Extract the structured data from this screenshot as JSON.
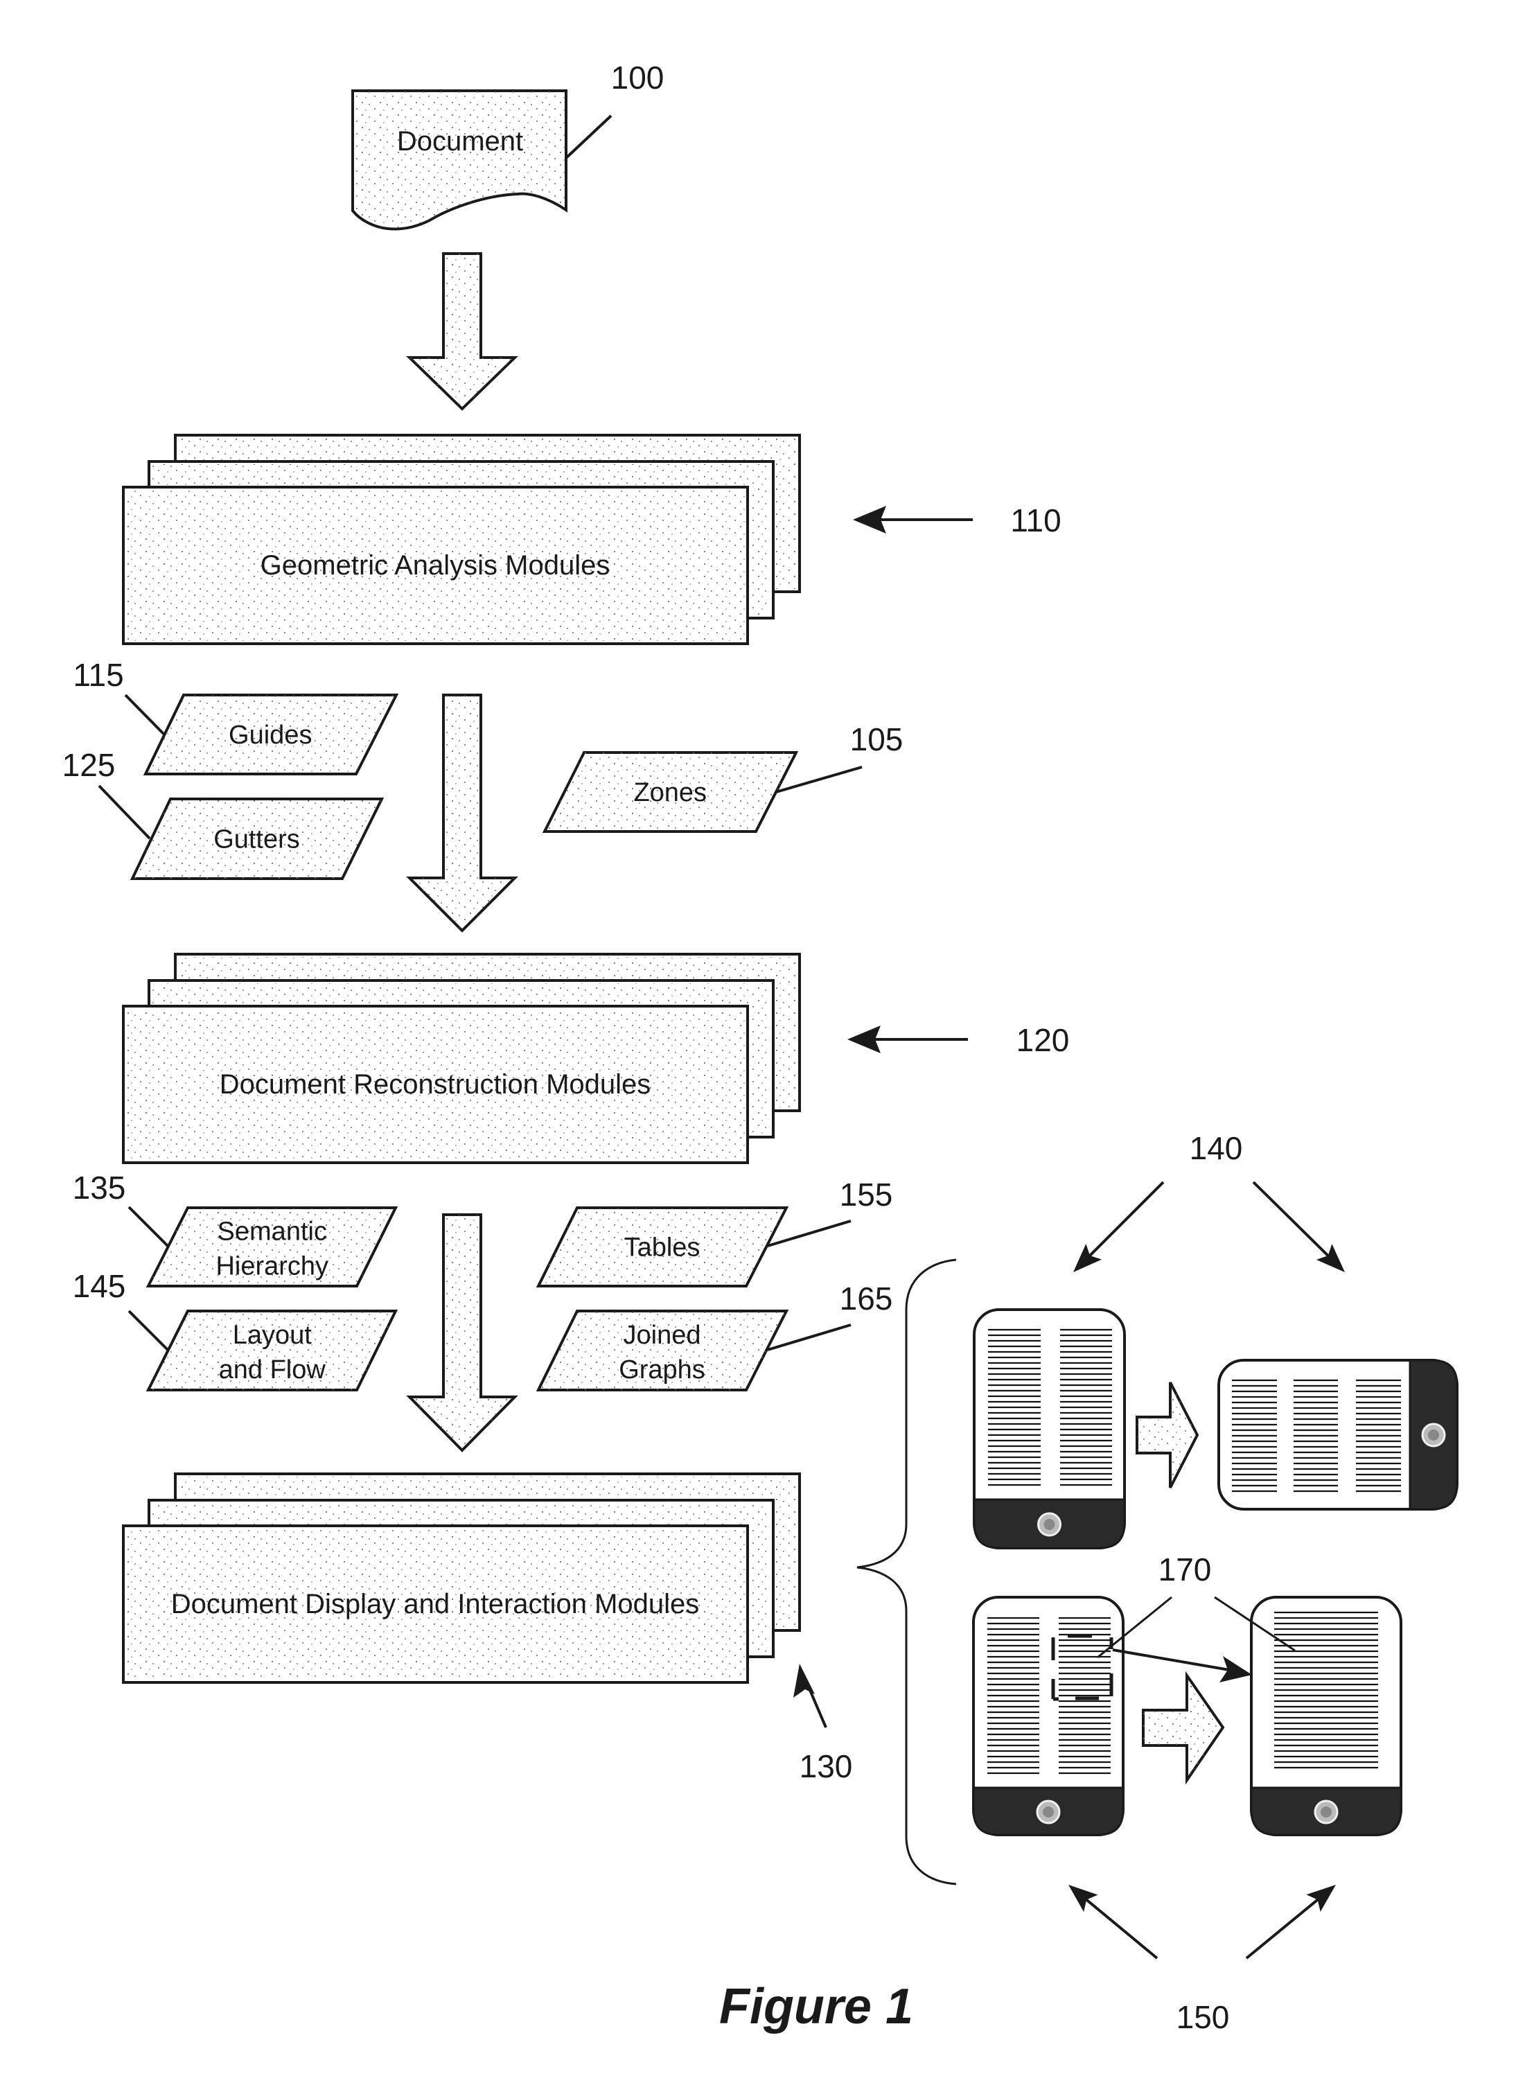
{
  "figure": {
    "title": "Figure 1",
    "colors": {
      "ink": "#1a1a1a",
      "device_body": "#2a2a2a",
      "paper": "#ffffff"
    }
  },
  "document": {
    "label": "Document",
    "ref": "100"
  },
  "modules": [
    {
      "id": "geometric",
      "label": "Geometric Analysis Modules",
      "ref": "110"
    },
    {
      "id": "reconstruction",
      "label": "Document Reconstruction Modules",
      "ref": "120"
    },
    {
      "id": "display",
      "label": "Document Display and Interaction Modules",
      "ref": "130"
    }
  ],
  "data_structures": [
    {
      "id": "guides",
      "lines": [
        "Guides"
      ],
      "ref": "115"
    },
    {
      "id": "gutters",
      "lines": [
        "Gutters"
      ],
      "ref": "125"
    },
    {
      "id": "zones",
      "lines": [
        "Zones"
      ],
      "ref": "105"
    },
    {
      "id": "semantic-hierarchy",
      "lines": [
        "Semantic",
        "Hierarchy"
      ],
      "ref": "135"
    },
    {
      "id": "layout-and-flow",
      "lines": [
        "Layout",
        "and Flow"
      ],
      "ref": "145"
    },
    {
      "id": "tables",
      "lines": [
        "Tables"
      ],
      "ref": "155"
    },
    {
      "id": "joined-graphs",
      "lines": [
        "Joined",
        "Graphs"
      ],
      "ref": "165"
    }
  ],
  "devices": {
    "rotation_ref": "140",
    "zoom_ref": "150",
    "selection_ref": "170"
  }
}
